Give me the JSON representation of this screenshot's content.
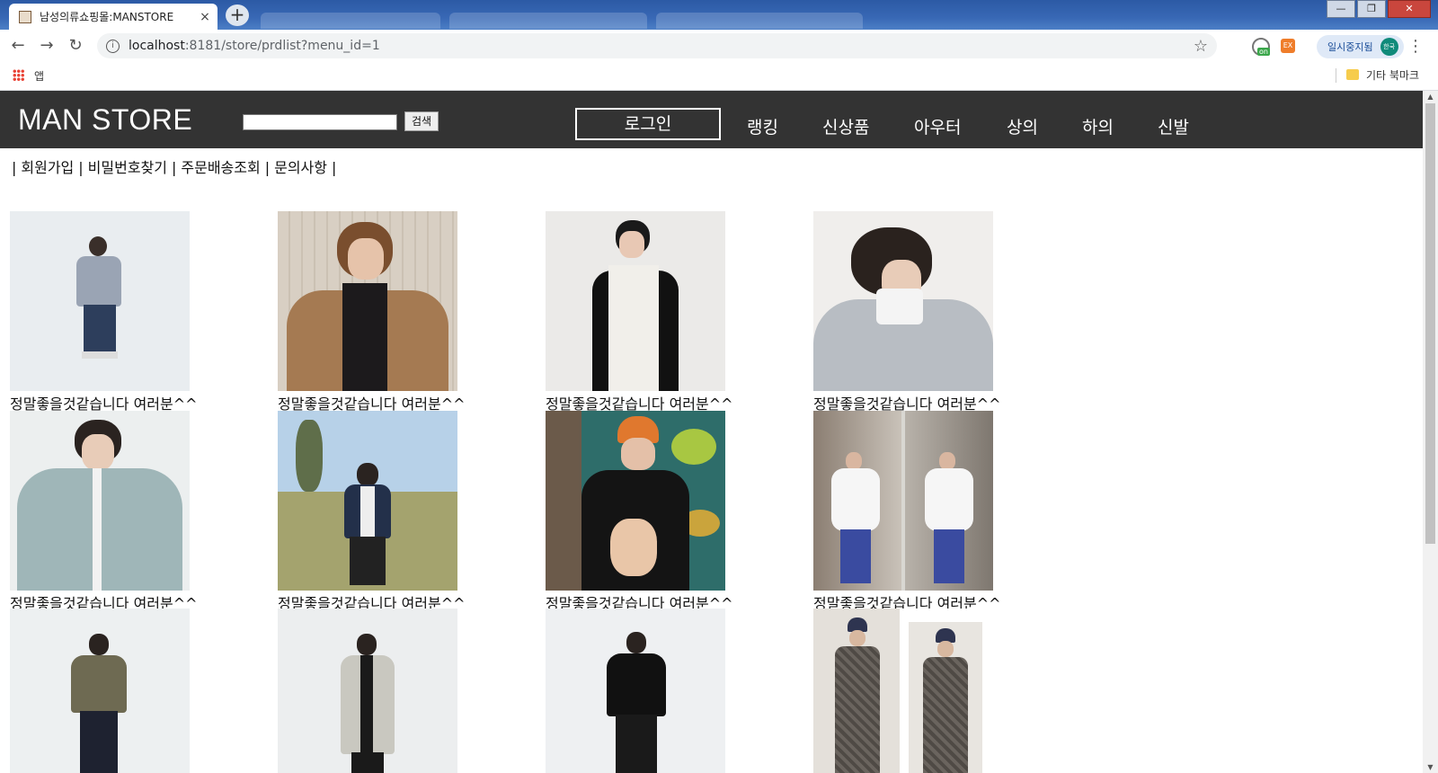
{
  "browser": {
    "tab_title": "남성의류쇼핑몰:MANSTORE",
    "tab_close": "×",
    "new_tab": "+",
    "url_host": "localhost",
    "url_rest": ":8181/store/prdlist?menu_id=1",
    "paused_label": "일시중지됨",
    "avatar_text": "한국",
    "ext_badge": "on",
    "ext2_label": "EX",
    "apps_label": "앱",
    "other_bookmarks": "기타 북마크"
  },
  "site": {
    "logo": "MAN STORE",
    "search_button": "검색",
    "search_value": "",
    "login_label": "로그인",
    "nav": [
      "랭킹",
      "신상품",
      "아우터",
      "상의",
      "하의",
      "신발"
    ],
    "subnav": [
      "회원가입",
      "비밀번호찾기",
      "주문배송조회",
      "문의사항"
    ],
    "subnav_sep": "|"
  },
  "products": [
    {
      "caption": "정말좋을것같습니다 여러분^^",
      "image": "knit-sweater-photo"
    },
    {
      "caption": "정말좋을것같습니다 여러분^^",
      "image": "camel-coat-photo"
    },
    {
      "caption": "정말좋을것같습니다 여러분^^",
      "image": "white-vest-photo"
    },
    {
      "caption": "정말좋을것같습니다 여러분^^",
      "image": "grey-jacket-photo"
    },
    {
      "caption": "정말좋을것같습니다 여러분^^",
      "image": "mint-jacket-photo"
    },
    {
      "caption": "정말좋을것같습니다 여러분^^",
      "image": "denim-jacket-photo"
    },
    {
      "caption": "정말좋을것같습니다 여러분^^",
      "image": "graphic-hoodie-photo"
    },
    {
      "caption": "정말좋을것같습니다 여러분^^",
      "image": "white-hoodie-photo"
    },
    {
      "caption": "",
      "image": "khaki-sweater-photo"
    },
    {
      "caption": "",
      "image": "grey-long-coat-photo"
    },
    {
      "caption": "",
      "image": "black-knit-photo"
    },
    {
      "caption": "",
      "image": "check-coat-photo"
    }
  ],
  "colors": {
    "header_bg": "#333333",
    "chrome_title": "#2c5aa5"
  }
}
